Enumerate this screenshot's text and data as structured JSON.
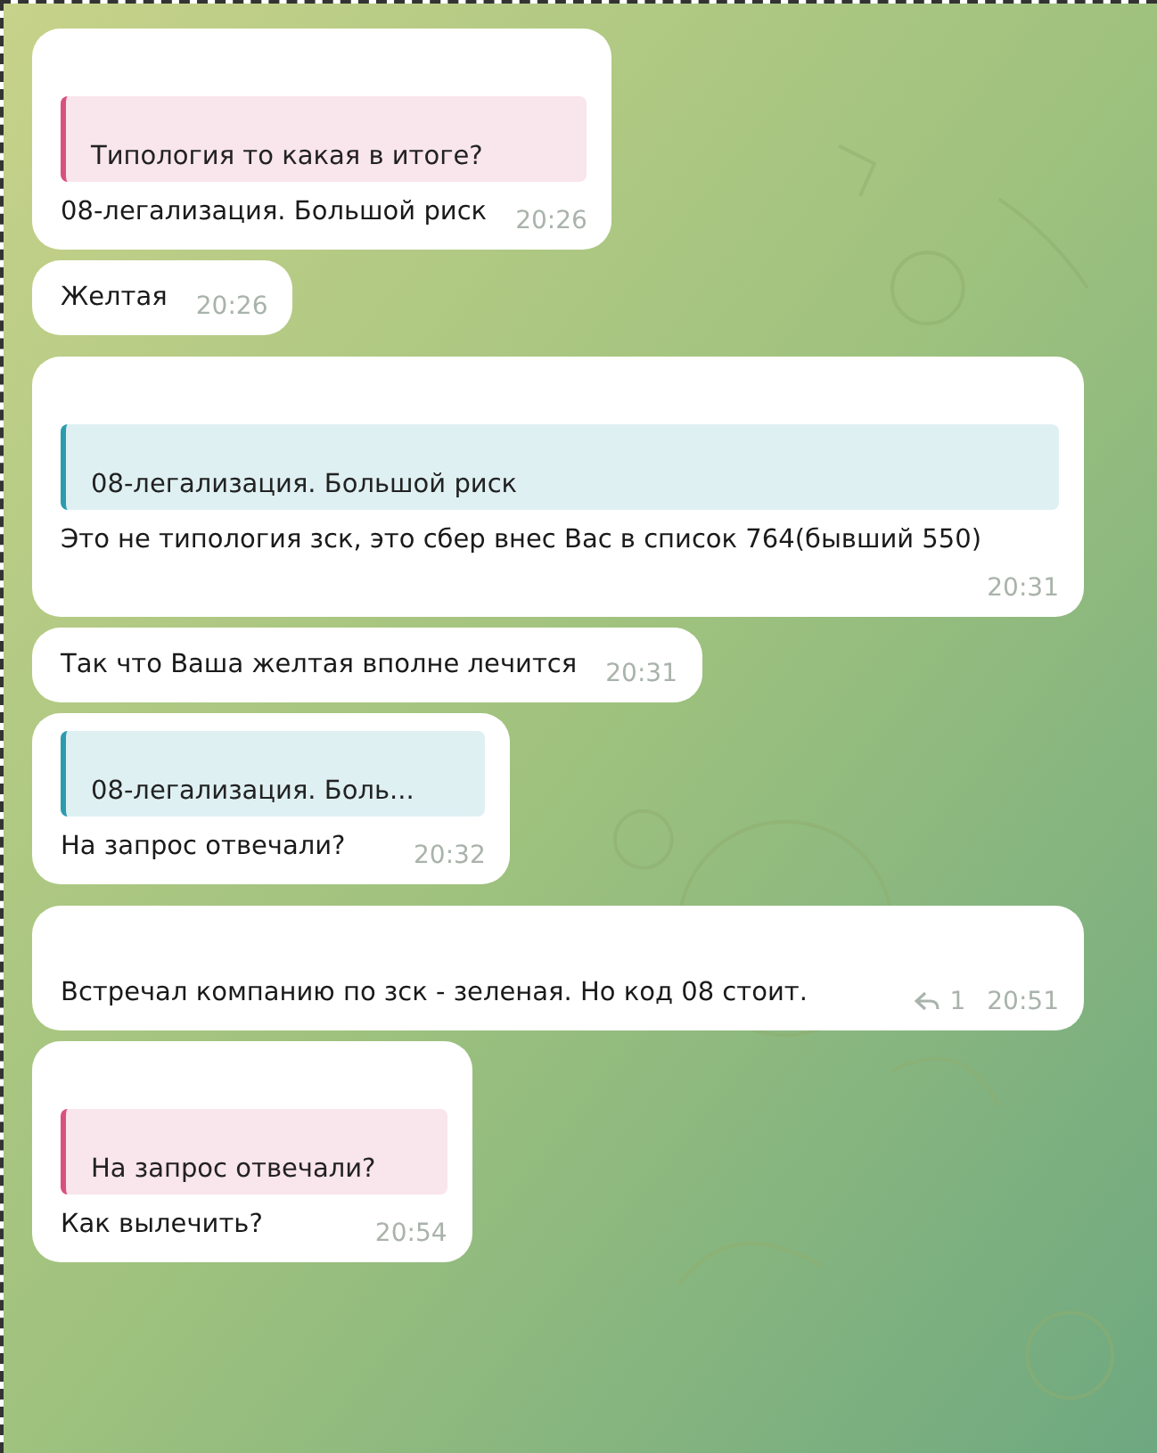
{
  "messages": [
    {
      "quote": {
        "text": "Типология то какая в итоге?",
        "color": "#d9507e"
      },
      "text": "08-легализация. Большой риск",
      "time": "20:26"
    },
    {
      "text": "Желтая",
      "time": "20:26"
    },
    {
      "quote": {
        "text": "08-легализация. Большой риск",
        "color": "#2b9cae"
      },
      "text": "Это не типология зск, это сбер внес Вас в список 764(бывший 550)",
      "time": "20:31"
    },
    {
      "text": "Так что Ваша желтая вполне лечится",
      "time": "20:31"
    },
    {
      "quote": {
        "text": "08-легализация. Боль...",
        "color": "#2b9cae"
      },
      "text": "На запрос отвечали?",
      "time": "20:32"
    },
    {
      "text": "Встречал компанию по зск - зеленая. Но код 08 стоит.",
      "replies": "1",
      "time": "20:51"
    },
    {
      "quote": {
        "text": "На запрос отвечали?",
        "color": "#d9507e"
      },
      "text": "Как вылечить?",
      "time": "20:54"
    }
  ]
}
